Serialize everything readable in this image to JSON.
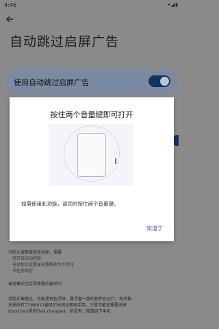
{
  "status_bar": {
    "time": "4:46",
    "icons": "▾◢▮"
  },
  "page": {
    "title": "自动跳过启屏广告"
  },
  "master_switch": {
    "label": "使用自动跳过启屏广告",
    "on": true
  },
  "background_notes": {
    "line1": "为防止服务被系统关闭，需要",
    "line2": "打开自启动权限",
    "line3": "电池优化设置省电策略改为不优化",
    "line4": "多任务锁定",
    "line5": "省电模式也会导致服务被关闭",
    "line6": "若阻止被跳过，可能是有些浮球、悬浮窗一类的软件在运行。先关掉",
    "line7": "关掉后打了(MIUI12最吸引关闭全面屏手势，三星可能还需要关掉",
    "line8": "Good lock里的Task changer)。若没有，就重启下手机"
  },
  "dialog": {
    "title": "按住两个音量键即可打开",
    "body": "如需使用此功能，请同时按住两个音量键。",
    "ok_label": "知道了"
  },
  "colors": {
    "accent_dark": "#12355e",
    "dialog_button": "#3d5fb5",
    "scrim": "#8a8a8a"
  }
}
